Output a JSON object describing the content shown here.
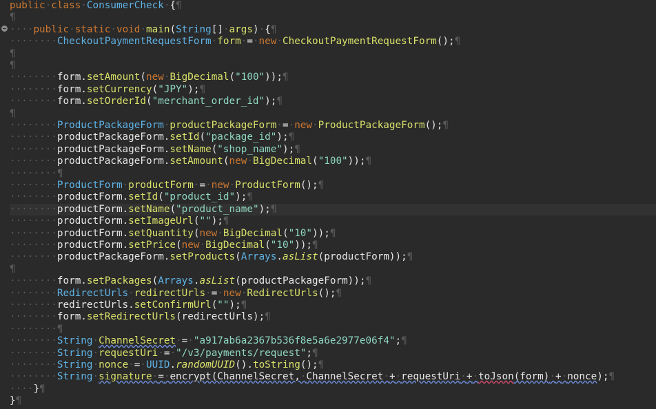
{
  "editor": {
    "colors": {
      "background": "#2a2a2a",
      "keyword": "#cc7832",
      "type": "#5fb3e6",
      "variable": "#d8e06a",
      "string": "#8fd7c2",
      "default": "#e6e6e6",
      "whitespace": "#5a5a5a"
    },
    "gutter_icon": "collapse-icon",
    "lines": [
      [
        [
          "kw",
          "public"
        ],
        [
          "dot",
          "·"
        ],
        [
          "kw",
          "class"
        ],
        [
          "dot",
          "·"
        ],
        [
          "ty",
          "ConsumerCheck"
        ],
        [
          "dot",
          "·"
        ],
        [
          "dft",
          "{"
        ],
        [
          "pil",
          "¶"
        ]
      ],
      [
        [
          "pil",
          "¶"
        ]
      ],
      [
        [
          "dot",
          "····"
        ],
        [
          "kw",
          "public"
        ],
        [
          "dot",
          "·"
        ],
        [
          "kw",
          "static"
        ],
        [
          "dot",
          "·"
        ],
        [
          "kw",
          "void"
        ],
        [
          "dot",
          "·"
        ],
        [
          "mth",
          "main"
        ],
        [
          "dft",
          "("
        ],
        [
          "ty",
          "String"
        ],
        [
          "dft",
          "[]"
        ],
        [
          "dot",
          "·"
        ],
        [
          "var",
          "args"
        ],
        [
          "dft",
          ")"
        ],
        [
          "dot",
          "·"
        ],
        [
          "dft",
          "{"
        ],
        [
          "pil",
          "¶"
        ]
      ],
      [
        [
          "dot",
          "········"
        ],
        [
          "ty",
          "CheckoutPaymentRequestForm"
        ],
        [
          "dot",
          "·"
        ],
        [
          "var",
          "form"
        ],
        [
          "dot",
          "·"
        ],
        [
          "dft",
          "="
        ],
        [
          "dot",
          "·"
        ],
        [
          "kw",
          "new"
        ],
        [
          "dot",
          "·"
        ],
        [
          "mth",
          "CheckoutPaymentRequestForm"
        ],
        [
          "dft",
          "();"
        ],
        [
          "pil",
          "¶"
        ]
      ],
      [
        [
          "pil",
          "¶"
        ]
      ],
      [
        [
          "pil",
          "¶"
        ]
      ],
      [
        [
          "dot",
          "········"
        ],
        [
          "dft",
          "form."
        ],
        [
          "mth",
          "setAmount"
        ],
        [
          "dft",
          "("
        ],
        [
          "kw",
          "new"
        ],
        [
          "dot",
          "·"
        ],
        [
          "mth",
          "BigDecimal"
        ],
        [
          "dft",
          "("
        ],
        [
          "str",
          "\"100\""
        ],
        [
          "dft",
          "));"
        ],
        [
          "pil",
          "¶"
        ]
      ],
      [
        [
          "dot",
          "········"
        ],
        [
          "dft",
          "form."
        ],
        [
          "mth",
          "setCurrency"
        ],
        [
          "dft",
          "("
        ],
        [
          "str",
          "\"JPY\""
        ],
        [
          "dft",
          ");"
        ],
        [
          "pil",
          "¶"
        ]
      ],
      [
        [
          "dot",
          "········"
        ],
        [
          "dft",
          "form."
        ],
        [
          "mth",
          "setOrderId"
        ],
        [
          "dft",
          "("
        ],
        [
          "str",
          "\"merchant_order_id\""
        ],
        [
          "dft",
          ");"
        ],
        [
          "pil",
          "¶"
        ]
      ],
      [
        [
          "pil",
          "¶"
        ]
      ],
      [
        [
          "dot",
          "········"
        ],
        [
          "ty",
          "ProductPackageForm"
        ],
        [
          "dot",
          "·"
        ],
        [
          "var",
          "productPackageForm"
        ],
        [
          "dot",
          "·"
        ],
        [
          "dft",
          "="
        ],
        [
          "dot",
          "·"
        ],
        [
          "kw",
          "new"
        ],
        [
          "dot",
          "·"
        ],
        [
          "mth",
          "ProductPackageForm"
        ],
        [
          "dft",
          "();"
        ],
        [
          "pil",
          "¶"
        ]
      ],
      [
        [
          "dot",
          "········"
        ],
        [
          "dft",
          "productPackageForm."
        ],
        [
          "mth",
          "setId"
        ],
        [
          "dft",
          "("
        ],
        [
          "str",
          "\"package_id\""
        ],
        [
          "dft",
          ");"
        ],
        [
          "pil",
          "¶"
        ]
      ],
      [
        [
          "dot",
          "········"
        ],
        [
          "dft",
          "productPackageForm."
        ],
        [
          "mth",
          "setName"
        ],
        [
          "dft",
          "("
        ],
        [
          "str",
          "\"shop_name\""
        ],
        [
          "dft",
          ");"
        ],
        [
          "pil",
          "¶"
        ]
      ],
      [
        [
          "dot",
          "········"
        ],
        [
          "dft",
          "productPackageForm."
        ],
        [
          "mth",
          "setAmount"
        ],
        [
          "dft",
          "("
        ],
        [
          "kw",
          "new"
        ],
        [
          "dot",
          "·"
        ],
        [
          "mth",
          "BigDecimal"
        ],
        [
          "dft",
          "("
        ],
        [
          "str",
          "\"100\""
        ],
        [
          "dft",
          "));"
        ],
        [
          "pil",
          "¶"
        ]
      ],
      [
        [
          "dot",
          "········"
        ],
        [
          "pil",
          "¶"
        ]
      ],
      [
        [
          "dot",
          "········"
        ],
        [
          "ty",
          "ProductForm"
        ],
        [
          "dot",
          "·"
        ],
        [
          "var",
          "productForm"
        ],
        [
          "dot",
          "·"
        ],
        [
          "dft",
          "="
        ],
        [
          "dot",
          "·"
        ],
        [
          "kw",
          "new"
        ],
        [
          "dot",
          "·"
        ],
        [
          "mth",
          "ProductForm"
        ],
        [
          "dft",
          "();"
        ],
        [
          "pil",
          "¶"
        ]
      ],
      [
        [
          "dot",
          "········"
        ],
        [
          "dft",
          "productForm."
        ],
        [
          "mth",
          "setId"
        ],
        [
          "dft",
          "("
        ],
        [
          "str",
          "\"product_id\""
        ],
        [
          "dft",
          ");"
        ],
        [
          "pil",
          "¶"
        ]
      ],
      [
        [
          "dot",
          "········"
        ],
        [
          "dft",
          "productForm."
        ],
        [
          "mth",
          "setName"
        ],
        [
          "dft",
          "("
        ],
        [
          "str",
          "\"product_name\""
        ],
        [
          "dft",
          ");"
        ],
        [
          "pil",
          "¶"
        ]
      ],
      [
        [
          "dot",
          "········"
        ],
        [
          "dft",
          "productForm."
        ],
        [
          "mth",
          "setImageUrl"
        ],
        [
          "dft",
          "("
        ],
        [
          "str",
          "\"\""
        ],
        [
          "dft",
          ");"
        ],
        [
          "pil",
          "¶"
        ]
      ],
      [
        [
          "dot",
          "········"
        ],
        [
          "dft",
          "productForm."
        ],
        [
          "mth",
          "setQuantity"
        ],
        [
          "dft",
          "("
        ],
        [
          "kw",
          "new"
        ],
        [
          "dot",
          "·"
        ],
        [
          "mth",
          "BigDecimal"
        ],
        [
          "dft",
          "("
        ],
        [
          "str",
          "\"10\""
        ],
        [
          "dft",
          "));"
        ],
        [
          "pil",
          "¶"
        ]
      ],
      [
        [
          "dot",
          "········"
        ],
        [
          "dft",
          "productForm."
        ],
        [
          "mth",
          "setPrice"
        ],
        [
          "dft",
          "("
        ],
        [
          "kw",
          "new"
        ],
        [
          "dot",
          "·"
        ],
        [
          "mth",
          "BigDecimal"
        ],
        [
          "dft",
          "("
        ],
        [
          "str",
          "\"10\""
        ],
        [
          "dft",
          "));"
        ],
        [
          "pil",
          "¶"
        ]
      ],
      [
        [
          "dot",
          "········"
        ],
        [
          "dft",
          "productPackageForm."
        ],
        [
          "mth",
          "setProducts"
        ],
        [
          "dft",
          "("
        ],
        [
          "ty",
          "Arrays"
        ],
        [
          "dft",
          "."
        ],
        [
          "mth it",
          "asList"
        ],
        [
          "dft",
          "(productForm));"
        ],
        [
          "pil",
          "¶"
        ]
      ],
      [
        [
          "pil",
          "¶"
        ]
      ],
      [
        [
          "dot",
          "········"
        ],
        [
          "dft",
          "form."
        ],
        [
          "mth",
          "setPackages"
        ],
        [
          "dft",
          "("
        ],
        [
          "ty",
          "Arrays"
        ],
        [
          "dft",
          "."
        ],
        [
          "mth it",
          "asList"
        ],
        [
          "dft",
          "(productPackageForm));"
        ],
        [
          "pil",
          "¶"
        ]
      ],
      [
        [
          "dot",
          "········"
        ],
        [
          "ty",
          "RedirectUrls"
        ],
        [
          "dot",
          "·"
        ],
        [
          "var",
          "redirectUrls"
        ],
        [
          "dot",
          "·"
        ],
        [
          "dft",
          "="
        ],
        [
          "dot",
          "·"
        ],
        [
          "kw",
          "new"
        ],
        [
          "dot",
          "·"
        ],
        [
          "mth",
          "RedirectUrls"
        ],
        [
          "dft",
          "();"
        ],
        [
          "pil",
          "¶"
        ]
      ],
      [
        [
          "dot",
          "········"
        ],
        [
          "dft",
          "redirectUrls."
        ],
        [
          "mth",
          "setConfirmUrl"
        ],
        [
          "dft",
          "("
        ],
        [
          "str",
          "\"\""
        ],
        [
          "dft",
          ");"
        ],
        [
          "pil",
          "¶"
        ]
      ],
      [
        [
          "dot",
          "········"
        ],
        [
          "dft",
          "form."
        ],
        [
          "mth",
          "setRedirectUrls"
        ],
        [
          "dft",
          "(redirectUrls);"
        ],
        [
          "pil",
          "¶"
        ]
      ],
      [
        [
          "dot",
          "········"
        ],
        [
          "pil",
          "¶"
        ]
      ],
      [
        [
          "dot",
          "········"
        ],
        [
          "ty",
          "String"
        ],
        [
          "dot",
          "·"
        ],
        [
          "var ul",
          "ChannelSecret"
        ],
        [
          "dot",
          "·"
        ],
        [
          "dft",
          "="
        ],
        [
          "dot",
          "·"
        ],
        [
          "str",
          "\"a917ab6a2367b536f8e5a6e2977e06f4\""
        ],
        [
          "dft",
          ";"
        ],
        [
          "pil",
          "¶"
        ]
      ],
      [
        [
          "dot",
          "········"
        ],
        [
          "ty",
          "String"
        ],
        [
          "dot",
          "·"
        ],
        [
          "var",
          "requestUri"
        ],
        [
          "dot",
          "·"
        ],
        [
          "dft",
          "="
        ],
        [
          "dot",
          "·"
        ],
        [
          "str",
          "\"/v3/payments/request\""
        ],
        [
          "dft",
          ";"
        ],
        [
          "pil",
          "¶"
        ]
      ],
      [
        [
          "dot",
          "········"
        ],
        [
          "ty",
          "String"
        ],
        [
          "dot",
          "·"
        ],
        [
          "var",
          "nonce"
        ],
        [
          "dot",
          "·"
        ],
        [
          "dft",
          "="
        ],
        [
          "dot",
          "·"
        ],
        [
          "ty",
          "UUID"
        ],
        [
          "dft",
          "."
        ],
        [
          "mth it",
          "randomUUID"
        ],
        [
          "dft",
          "()."
        ],
        [
          "mth",
          "toString"
        ],
        [
          "dft",
          "();"
        ],
        [
          "pil",
          "¶"
        ]
      ],
      [
        [
          "dot",
          "········"
        ],
        [
          "ty",
          "String"
        ],
        [
          "dot",
          "·"
        ],
        [
          "var ul",
          "signature"
        ],
        [
          "dot ul",
          "·"
        ],
        [
          "dft ul",
          "="
        ],
        [
          "dot ul",
          "·"
        ],
        [
          "dft ul",
          "encrypt(ChannelSecret,"
        ],
        [
          "dot ul",
          "·"
        ],
        [
          "dft ul",
          "ChannelSecret"
        ],
        [
          "dot ul",
          "·"
        ],
        [
          "dft ul",
          "+"
        ],
        [
          "dot ul",
          "·"
        ],
        [
          "dft ul",
          "requestUri"
        ],
        [
          "dot ul",
          "·"
        ],
        [
          "dft ul",
          "+"
        ],
        [
          "dot ul",
          "·"
        ],
        [
          "dft ulr",
          "toJson"
        ],
        [
          "dft ul",
          "(form)"
        ],
        [
          "dot ul",
          "·"
        ],
        [
          "dft ul",
          "+"
        ],
        [
          "dot ul",
          "·"
        ],
        [
          "dft ul",
          "nonce"
        ],
        [
          "dft",
          ");"
        ],
        [
          "pil",
          "¶"
        ]
      ],
      [
        [
          "dot",
          "····"
        ],
        [
          "dft",
          "}"
        ],
        [
          "pil",
          "¶"
        ]
      ],
      [
        [
          "dft",
          "}"
        ],
        [
          "pil",
          "¶"
        ]
      ]
    ],
    "current_line_index": 17
  }
}
